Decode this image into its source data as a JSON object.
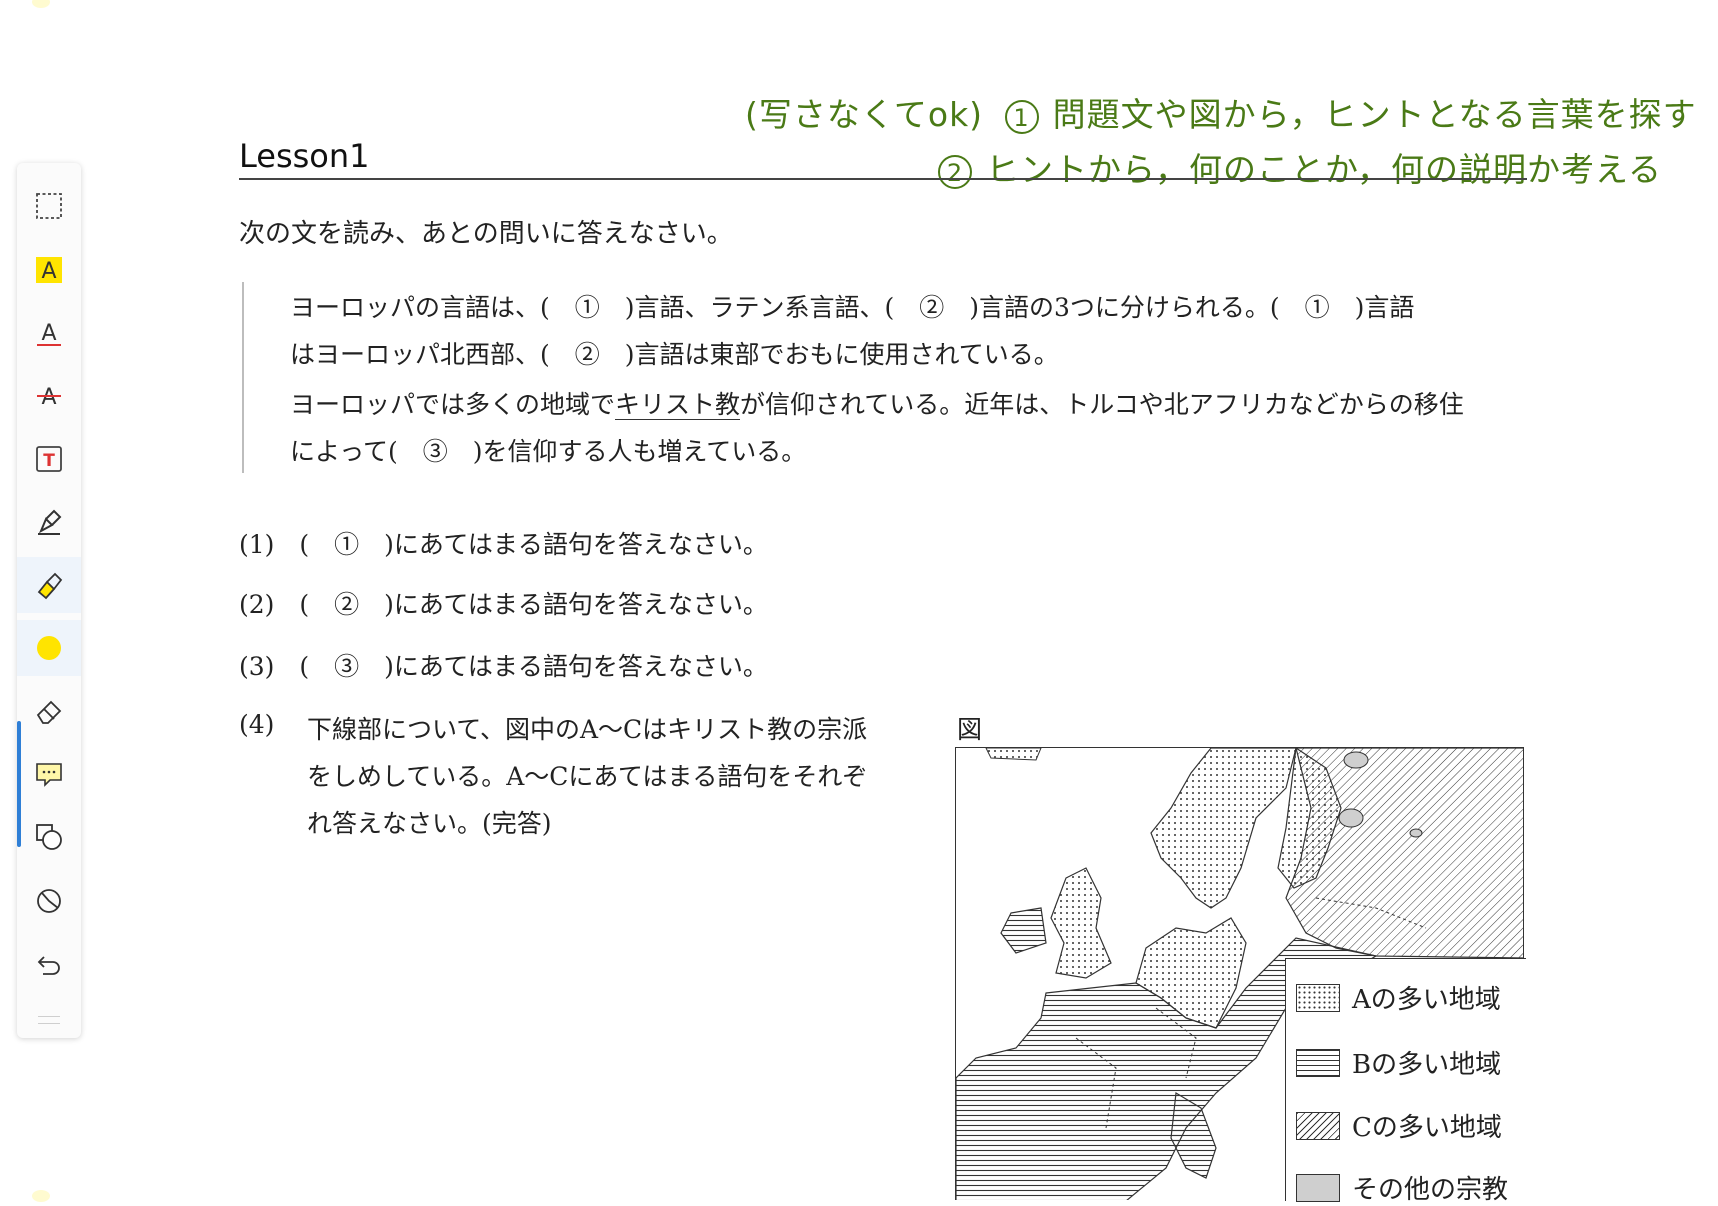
{
  "toolbar": {
    "tools": [
      {
        "name": "select-tool",
        "icon": "marquee-select-icon"
      },
      {
        "name": "text-highlight-tool",
        "icon": "highlight-text-icon"
      },
      {
        "name": "underline-tool",
        "icon": "underline-text-icon"
      },
      {
        "name": "strikethrough-tool",
        "icon": "strikethrough-text-icon"
      },
      {
        "name": "textbox-tool",
        "icon": "text-box-icon"
      },
      {
        "name": "pen-tool",
        "icon": "pen-icon"
      },
      {
        "name": "highlighter-tool",
        "icon": "highlighter-icon"
      },
      {
        "name": "color-picker",
        "icon": "color-dot-icon"
      },
      {
        "name": "eraser-tool",
        "icon": "eraser-icon"
      },
      {
        "name": "comment-tool",
        "icon": "comment-icon"
      },
      {
        "name": "shape-tool",
        "icon": "shapes-icon"
      },
      {
        "name": "lasso-tool",
        "icon": "lasso-icon"
      },
      {
        "name": "undo-button",
        "icon": "undo-icon"
      }
    ],
    "active_color": "#ffe400",
    "accent": "#2f7fd6",
    "text_letter": "A",
    "textbox_letter": "T"
  },
  "annotations": {
    "line1_prefix": "(写さなくてok)",
    "line1_num": "1",
    "line1_text": "問題文や図から，ヒントとなる言葉を探す",
    "line2_num": "2",
    "line2_text": "ヒントから，何のことか，何の説明か考える",
    "ink_color": "#4a7a16"
  },
  "lesson_title": "Lesson1",
  "instruction": "次の文を読み、あとの問いに答えなさい。",
  "passage": {
    "line1": "ヨーロッパの言語は、(　①　)言語、ラテン系言語、(　②　)言語の3つに分けられる。(　①　)言語",
    "line2": "はヨーロッパ北西部、(　②　)言語は東部でおもに使用されている。",
    "line3_before": "ヨーロッパでは多くの地域で",
    "line3_underlined": "キリスト教",
    "line3_after": "が信仰されている。近年は、トルコや北アフリカなどからの移住",
    "line4": "によって(　③　)を信仰する人も増えている。"
  },
  "questions": {
    "q1": "(1)　(　①　)にあてはまる語句を答えなさい。",
    "q2": "(2)　(　②　)にあてはまる語句を答えなさい。",
    "q3": "(3)　(　③　)にあてはまる語句を答えなさい。",
    "q4_label": "(4)",
    "q4_line1": "下線部について、図中のA～Cはキリスト教の宗派",
    "q4_line2": "をしめしている。A～Cにあてはまる語句をそれぞ",
    "q4_line3": "れ答えなさい。(完答)"
  },
  "figure": {
    "label": "図",
    "legend": [
      {
        "pattern": "dotted",
        "text": "Aの多い地域"
      },
      {
        "pattern": "horizontal",
        "text": "Bの多い地域"
      },
      {
        "pattern": "diagonal",
        "text": "Cの多い地域"
      },
      {
        "pattern": "grey",
        "text": "その他の宗教"
      }
    ]
  }
}
